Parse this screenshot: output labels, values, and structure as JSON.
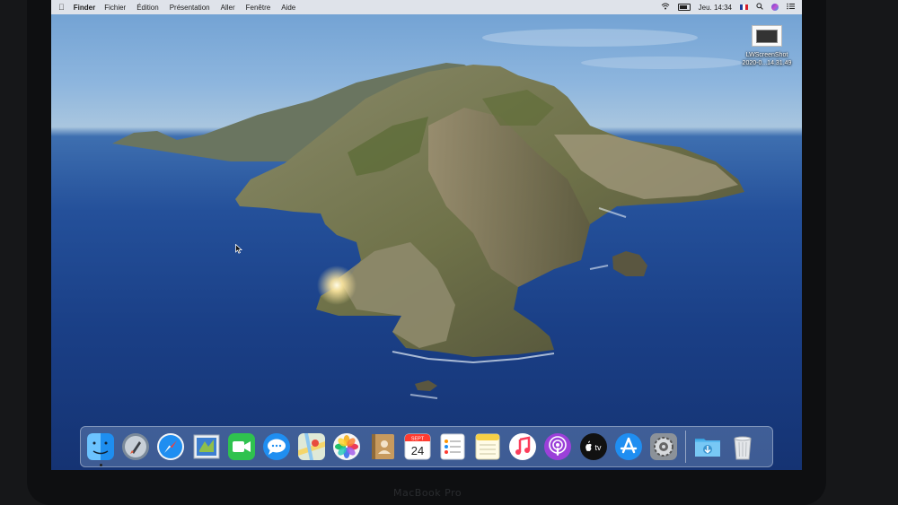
{
  "menubar": {
    "app": "Finder",
    "items": [
      "Fichier",
      "Édition",
      "Présentation",
      "Aller",
      "Fenêtre",
      "Aide"
    ],
    "clock": "Jeu. 14:34"
  },
  "desktop_icon": {
    "name": "LWScreenShot",
    "sub": "2020-0...14.31.49"
  },
  "hardware": {
    "label": "MacBook Pro"
  },
  "colors": {
    "menubar_bg": "#e8e8ec",
    "sea": "#1a3f86",
    "sky": "#8eb6de"
  },
  "dock": {
    "apps": [
      "finder-icon",
      "launchpad-icon",
      "safari-icon",
      "mail-icon",
      "facetime-icon",
      "messages-icon",
      "maps-icon",
      "photos-icon",
      "contacts-icon",
      "calendar-icon",
      "reminders-icon",
      "notes-icon",
      "music-icon",
      "podcasts-icon",
      "apple-tv-icon",
      "app-store-icon",
      "system-preferences-icon"
    ],
    "calendar_month": "SEPT",
    "calendar_day": "24",
    "tv_label": "tv",
    "extras": [
      "downloads-folder-icon",
      "trash-icon"
    ]
  }
}
